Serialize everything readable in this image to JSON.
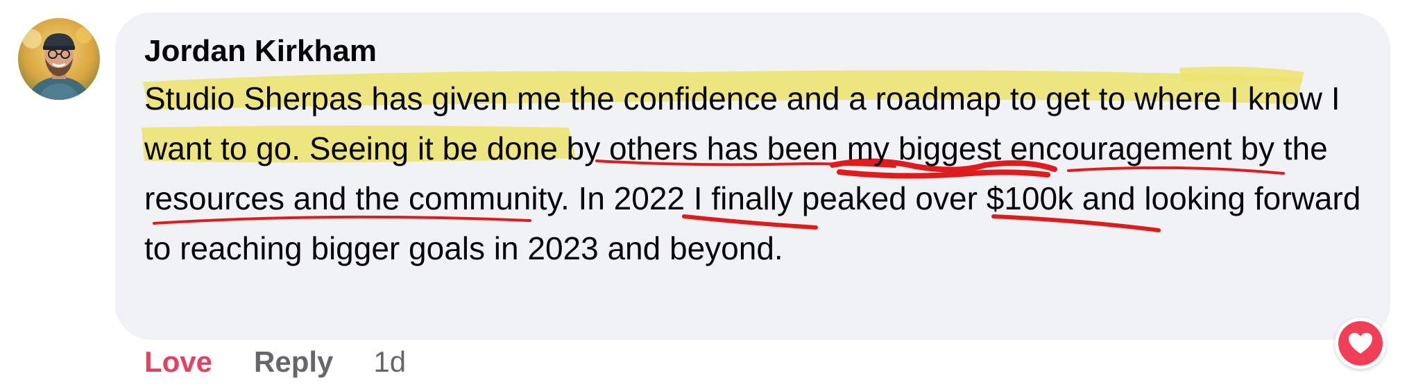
{
  "comment": {
    "author": "Jordan Kirkham",
    "text": {
      "segment_highlighted": "Studio Sherpas has given me the confidence and a roadmap to get to where I know I want to go",
      "segment_rest": ". Seeing it be done by others has been my biggest encouragement by the resources and the community. In 2022 I finally peaked over $100k and looking forward to reaching bigger goals in 2023 and beyond."
    },
    "annotations": {
      "highlight_color": "#ece36b",
      "underline_color": "#e11b1b"
    }
  },
  "actions": {
    "love_label": "Love",
    "reply_label": "Reply",
    "timestamp": "1d",
    "love_color": "#e4405f"
  },
  "reaction": {
    "icon": "heart-icon",
    "color": "#f33e58"
  },
  "avatar": {
    "icon": "avatar-photo"
  }
}
